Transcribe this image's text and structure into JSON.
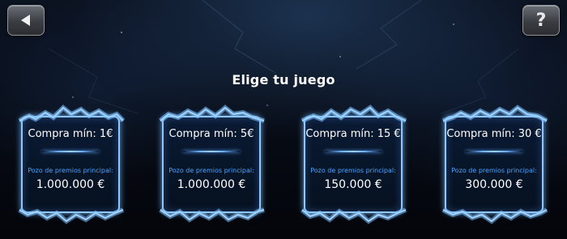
{
  "header": {
    "back_button": {
      "icon": "back-arrow-icon"
    },
    "help_button": {
      "label": "?",
      "icon": "help-icon"
    }
  },
  "screen": {
    "title": "Elige tu juego"
  },
  "games": [
    {
      "buyin": "Compra mín: 1€",
      "prize_label": "Pozo de premios principal:",
      "prize": "1.000.000 €"
    },
    {
      "buyin": "Compra mín: 5€",
      "prize_label": "Pozo de premios principal:",
      "prize": "1.000.000 €"
    },
    {
      "buyin": "Compra mín: 15 €",
      "prize_label": "Pozo de premios principal:",
      "prize": "150.000 €"
    },
    {
      "buyin": "Compra mín: 30 €",
      "prize_label": "Pozo de premios principal:",
      "prize": "300.000 €"
    }
  ],
  "colors": {
    "card_border": "#8fc6ff",
    "prize_label": "#4aa3ff",
    "text": "#ffffff"
  }
}
